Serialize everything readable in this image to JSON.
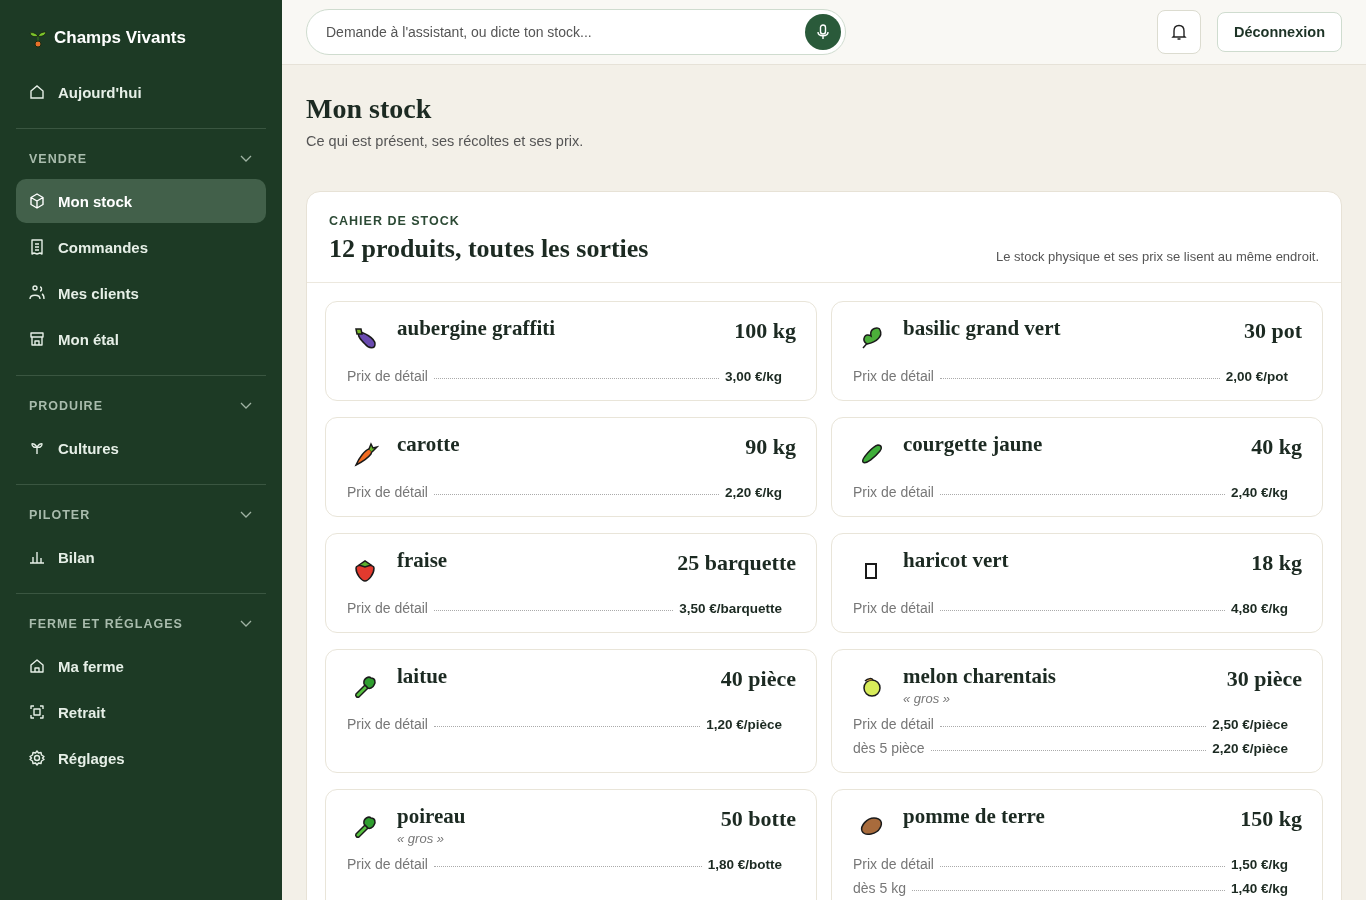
{
  "brand": {
    "name": "Champs Vivants"
  },
  "sidebar": {
    "top_items": [
      {
        "label": "Aujourd'hui",
        "kind": "home",
        "selected": false
      }
    ],
    "sections": [
      {
        "title": "VENDRE",
        "items": [
          {
            "label": "Mon stock",
            "kind": "box",
            "selected": true
          },
          {
            "label": "Commandes",
            "kind": "receipt",
            "selected": false
          },
          {
            "label": "Mes clients",
            "kind": "people",
            "selected": false
          },
          {
            "label": "Mon étal",
            "kind": "store",
            "selected": false
          }
        ]
      },
      {
        "title": "PRODUIRE",
        "items": [
          {
            "label": "Cultures",
            "kind": "sprout",
            "selected": false
          }
        ]
      },
      {
        "title": "PILOTER",
        "items": [
          {
            "label": "Bilan",
            "kind": "chart",
            "selected": false
          }
        ]
      },
      {
        "title": "FERME ET RÉGLAGES",
        "items": [
          {
            "label": "Ma ferme",
            "kind": "home",
            "selected": false
          },
          {
            "label": "Retrait",
            "kind": "scan",
            "selected": false
          },
          {
            "label": "Réglages",
            "kind": "gear",
            "selected": false
          }
        ]
      }
    ]
  },
  "topbar": {
    "search": {
      "placeholder": "Demande à l'assistant, ou dicte ton stock..."
    },
    "logout_button": "Déconnexion"
  },
  "page": {
    "title": "Mon stock",
    "subtitle": "Ce qui est présent, ses récoltes et ses prix."
  },
  "stock_panel": {
    "eyebrow": "CAHIER DE STOCK",
    "title": "12 produits, toutes les sorties",
    "note": "Le stock physique et ses prix se lisent au même endroit.",
    "products": [
      {
        "kind": "eggplant",
        "name": "aubergine graffiti",
        "quantity": "100 kg",
        "prices": [
          {
            "label": "Prix de détail",
            "value": "3,00 €/kg"
          }
        ]
      },
      {
        "kind": "herb",
        "name": "basilic grand vert",
        "quantity": "30 pot",
        "prices": [
          {
            "label": "Prix de détail",
            "value": "2,00 €/pot"
          }
        ]
      },
      {
        "kind": "carrot",
        "name": "carotte",
        "quantity": "90 kg",
        "prices": [
          {
            "label": "Prix de détail",
            "value": "2,20 €/kg"
          }
        ]
      },
      {
        "kind": "cucumber",
        "name": "courgette jaune",
        "quantity": "40 kg",
        "prices": [
          {
            "label": "Prix de détail",
            "value": "2,40 €/kg"
          }
        ]
      },
      {
        "kind": "strawberry",
        "name": "fraise",
        "quantity": "25 barquette",
        "prices": [
          {
            "label": "Prix de détail",
            "value": "3,50 €/barquette"
          }
        ]
      },
      {
        "kind": "missing",
        "name": "haricot vert",
        "quantity": "18 kg",
        "prices": [
          {
            "label": "Prix de détail",
            "value": "4,80 €/kg"
          }
        ]
      },
      {
        "kind": "leafy",
        "name": "laitue",
        "quantity": "40 pièce",
        "prices": [
          {
            "label": "Prix de détail",
            "value": "1,20 €/pièce"
          }
        ]
      },
      {
        "kind": "melon",
        "name": "melon charentais",
        "variety": "« gros »",
        "quantity": "30 pièce",
        "prices": [
          {
            "label": "Prix de détail",
            "value": "2,50 €/pièce"
          },
          {
            "label": "dès 5 pièce",
            "value": "2,20 €/pièce"
          }
        ]
      },
      {
        "kind": "leafy",
        "name": "poireau",
        "variety": "« gros »",
        "quantity": "50 botte",
        "prices": [
          {
            "label": "Prix de détail",
            "value": "1,80 €/botte"
          }
        ]
      },
      {
        "kind": "potato",
        "name": "pomme de terre",
        "quantity": "150 kg",
        "prices": [
          {
            "label": "Prix de détail",
            "value": "1,50 €/kg"
          },
          {
            "label": "dès 5 kg",
            "value": "1,40 €/kg"
          }
        ]
      }
    ]
  }
}
